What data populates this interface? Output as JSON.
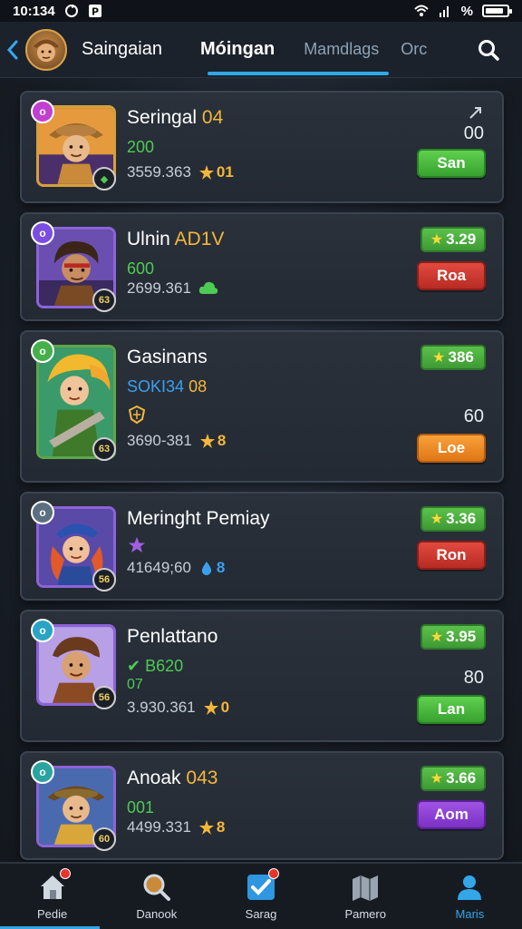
{
  "status_bar": {
    "time": "10:134",
    "battery_text": "%",
    "battery_level": 0.85
  },
  "header": {
    "tabs": [
      {
        "label": "Saingaian"
      },
      {
        "label": "Móingan"
      },
      {
        "label": "Mamdlags"
      },
      {
        "label": "Orc"
      }
    ],
    "active_tab": 1
  },
  "list": [
    {
      "rank": "o",
      "rank_color": "#c23fd0",
      "name": "Seringal",
      "name_accent": "04",
      "sub": "200",
      "meta": "3559.363",
      "coin": "01",
      "count": "00",
      "action": "San",
      "action_style": "green",
      "frame": "gold"
    },
    {
      "rank": "o",
      "rank_color": "#7a4ee0",
      "name": "Ulnin",
      "name_accent": "AD1V",
      "rating": "3.29",
      "sub": "600",
      "meta": "2699.361",
      "action": "Roa",
      "action_style": "red",
      "frame": "purple",
      "level": "63"
    },
    {
      "rank": "o",
      "rank_color": "#45b04a",
      "name": "Gasinans",
      "rating": "386",
      "sub": "SOKI34",
      "sub_accent": "08",
      "meta": "3690-381",
      "coin": "8",
      "count": "60",
      "action": "Loe",
      "action_style": "orange",
      "frame": "green",
      "level": "63"
    },
    {
      "rank": "o",
      "rank_color": "#5a6f7f",
      "name": "Meringht Pemiay",
      "rating": "3.36",
      "meta": "41649;60",
      "coin": "8",
      "action": "Ron",
      "action_style": "red",
      "frame": "purple",
      "level": "56"
    },
    {
      "rank": "o",
      "rank_color": "#2aa4c4",
      "name": "Penlattano",
      "rating": "3.95",
      "sub": "B620",
      "sub2": "07",
      "meta": "3.930.361",
      "coin": "0",
      "count": "80",
      "action": "Lan",
      "action_style": "green",
      "frame": "purple",
      "level": "56"
    },
    {
      "rank": "o",
      "rank_color": "#2aa4a0",
      "name": "Anoak",
      "name_accent": "043",
      "rating": "3.66",
      "sub": "001",
      "meta": "4499.331",
      "coin": "8",
      "action": "Aom",
      "action_style": "purple",
      "frame": "purple",
      "level": "60"
    }
  ],
  "bottom_nav": [
    {
      "label": "Pedie",
      "icon": "home-icon",
      "badge": true
    },
    {
      "label": "Danook",
      "icon": "search-icon",
      "badge": false
    },
    {
      "label": "Sarag",
      "icon": "check-icon",
      "badge": true
    },
    {
      "label": "Pamero",
      "icon": "map-icon",
      "badge": false
    },
    {
      "label": "Maris",
      "icon": "profile-icon",
      "badge": false,
      "active": true
    }
  ]
}
